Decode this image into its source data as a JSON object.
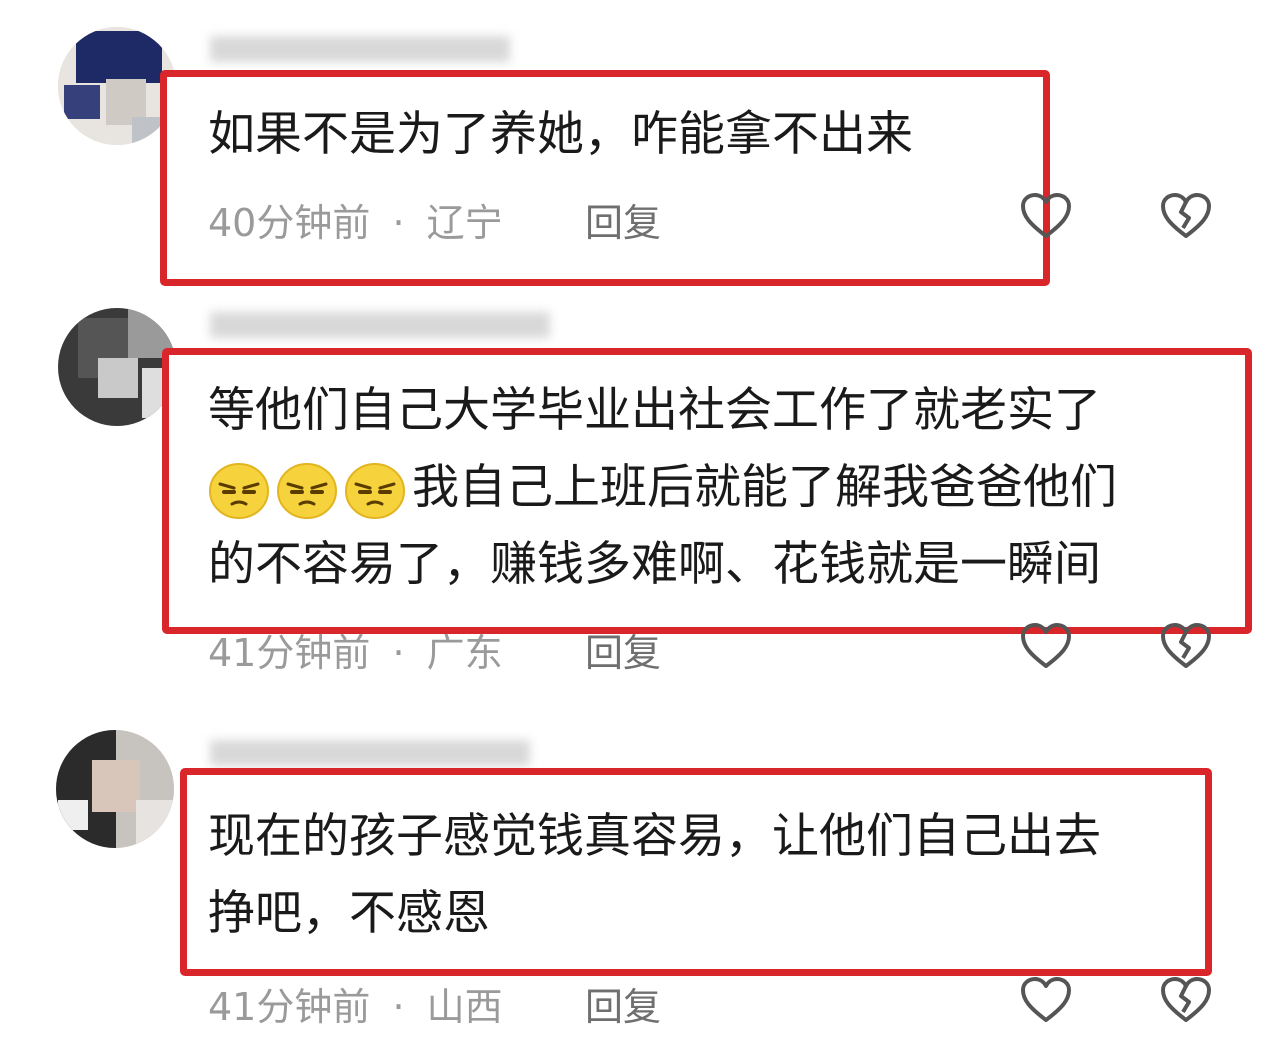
{
  "comments": [
    {
      "username": "",
      "text_lines": [
        "如果不是为了养她，咋能拿不出来"
      ],
      "time": "40分钟前",
      "location": "辽宁",
      "reply_label": "回复"
    },
    {
      "username": "",
      "text_lines": [
        "等他们自己大学毕业出社会工作了就老实了",
        "我自己上班后就能了解我爸爸他们",
        "的不容易了，赚钱多难啊、花钱就是一瞬间"
      ],
      "emoji_count": 3,
      "time": "41分钟前",
      "location": "广东",
      "reply_label": "回复"
    },
    {
      "username": "",
      "text_lines": [
        "现在的孩子感觉钱真容易，让他们自己出去",
        "挣吧，不感恩"
      ],
      "time": "41分钟前",
      "location": "山西",
      "reply_label": "回复"
    }
  ],
  "separator": "·",
  "icons": {
    "like": "heart-outline-icon",
    "dislike": "broken-heart-icon"
  },
  "colors": {
    "highlight_border": "#d9262a",
    "meta_text": "#9a9a9a",
    "body_text": "#1a1a1a"
  }
}
